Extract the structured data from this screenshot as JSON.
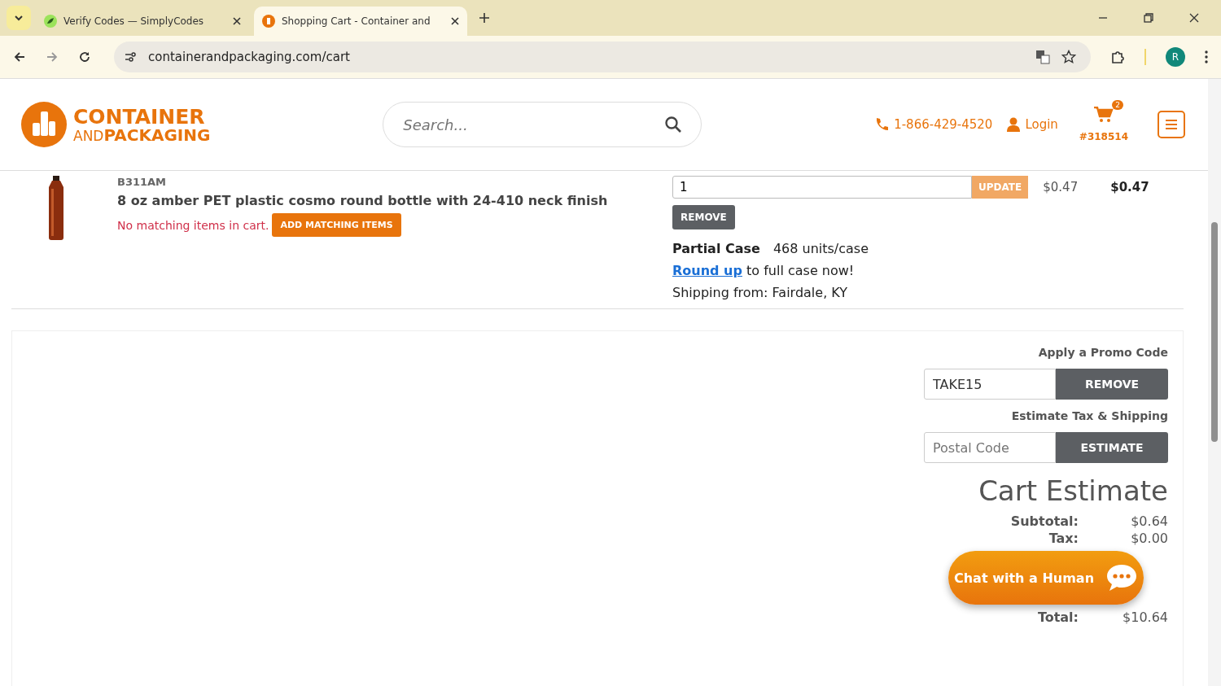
{
  "browser": {
    "tabs": [
      {
        "title": "Verify Codes — SimplyCodes",
        "selected": false
      },
      {
        "title": "Shopping Cart - Container and",
        "selected": true
      }
    ],
    "url": "containerandpackaging.com/cart",
    "profile_initial": "R"
  },
  "header": {
    "logo_top": "CONTAINER",
    "logo_and": "AND",
    "logo_bottom": "PACKAGING",
    "search_placeholder": "Search...",
    "phone": "1-866-429-4520",
    "login": "Login",
    "cart_count": "2",
    "cart_number": "#318514"
  },
  "item": {
    "sku": "B311AM",
    "name": "8 oz amber PET plastic cosmo round bottle with 24-410 neck finish",
    "matching_note": "No matching items in cart.",
    "matching_button": "ADD MATCHING ITEMS",
    "quantity": "1",
    "update_button": "UPDATE",
    "unit_price": "$0.47",
    "line_total": "$0.47",
    "remove_button": "REMOVE",
    "partial_case_label": "Partial Case",
    "units_per_case": "468 units/case",
    "round_up_link": "Round up",
    "round_up_rest": " to full case now!",
    "shipping_from": "Shipping from: Fairdale, KY"
  },
  "promo": {
    "heading": "Apply a Promo Code",
    "code": "TAKE15",
    "button": "REMOVE"
  },
  "estimate": {
    "heading": "Estimate Tax & Shipping",
    "placeholder": "Postal Code",
    "button": "ESTIMATE"
  },
  "cart_estimate": {
    "title": "Cart Estimate",
    "rows": [
      {
        "label": "Subtotal:",
        "value": "$0.64"
      },
      {
        "label": "Tax:",
        "value": "$0.00"
      },
      {
        "label": "Total:",
        "value": "$10.64"
      }
    ]
  },
  "chat": {
    "label": "Chat with a Human"
  }
}
